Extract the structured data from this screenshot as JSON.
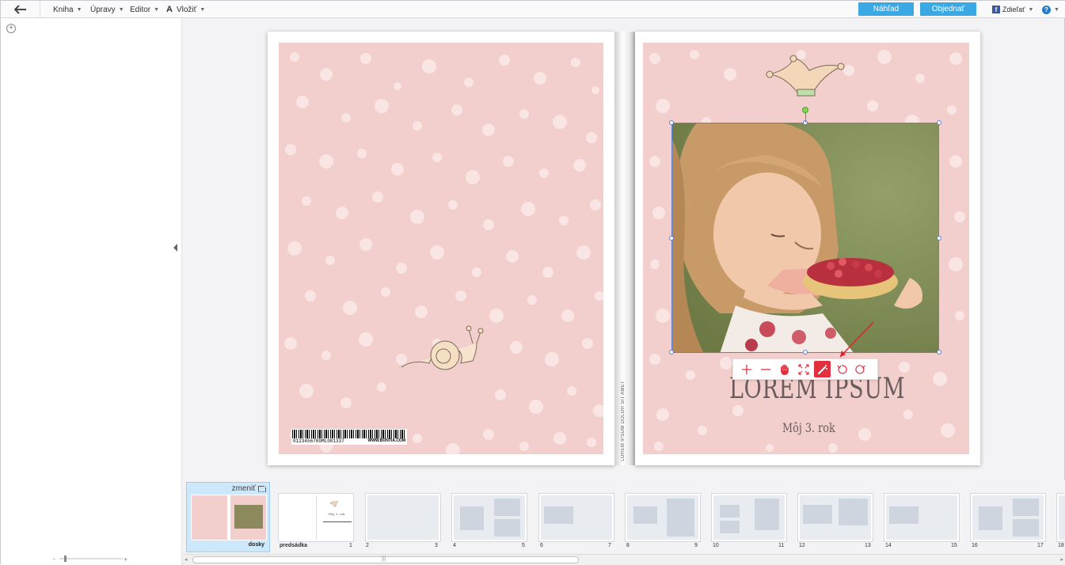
{
  "menu": {
    "kniha": "Kniha",
    "upravy": "Úpravy",
    "editor": "Editor",
    "vlozit": "Vložiť"
  },
  "buttons": {
    "nahlad": "Náhľad",
    "objednat": "Objednať",
    "zdielat": "Zdieľať"
  },
  "icons": {
    "back": "back-arrow-icon",
    "help": "help-icon",
    "facebook": "facebook-icon"
  },
  "cover": {
    "title": "LOREM IPSUM",
    "subtitle": "Môj 3. rok",
    "spine_text": "LOREM IPSUM DOLOR SIT AMET",
    "barcode_number": "0123456789ML001337",
    "barcode_web": "WWW.BONTIA.COM"
  },
  "photo_toolbar": [
    "zoom-in-icon",
    "zoom-out-icon",
    "hand-icon",
    "fit-icon",
    "magic-wand-icon",
    "rotate-left-icon",
    "rotate-right-icon"
  ],
  "filmstrip": {
    "change_label": "zmeniť",
    "cover_label": "dosky",
    "endpaper_label": "predsádka",
    "endpaper_title": "Môj 3. rok",
    "page_numbers": [
      "1",
      "2",
      "3",
      "4",
      "5",
      "6",
      "7",
      "8",
      "9",
      "10",
      "11",
      "12",
      "13",
      "14",
      "15",
      "16",
      "17",
      "18"
    ]
  },
  "colors": {
    "accent_blue": "#3aa8e3",
    "cover_pink": "#f2cfcc",
    "toolbar_active": "#e2303f",
    "selection": "#5b7ed6"
  }
}
